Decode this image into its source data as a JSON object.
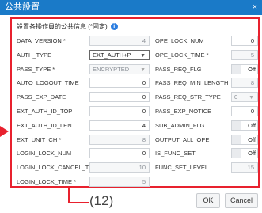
{
  "window": {
    "title": "公共設置",
    "close_label": "×"
  },
  "section": {
    "title": "設置各操作員的公共信息 (*固定)",
    "info_icon": "info-icon"
  },
  "left_fields": [
    {
      "label": "DATA_VERSION *",
      "value": "4",
      "kind": "readonly"
    },
    {
      "label": "AUTH_TYPE",
      "value": "EXT_AUTH+P",
      "kind": "select-active"
    },
    {
      "label": "PASS_TYPE *",
      "value": "ENCRYPTED",
      "kind": "select-disabled"
    },
    {
      "label": "AUTO_LOGOUT_TIME",
      "value": "0",
      "kind": "input"
    },
    {
      "label": "PASS_EXP_DATE",
      "value": "0",
      "kind": "input"
    },
    {
      "label": "EXT_AUTH_ID_TOP",
      "value": "0",
      "kind": "input"
    },
    {
      "label": "EXT_AUTH_ID_LEN",
      "value": "4",
      "kind": "input"
    },
    {
      "label": "EXT_UNIT_CH *",
      "value": "8",
      "kind": "readonly"
    },
    {
      "label": "LOGIN_LOCK_NUM",
      "value": "0",
      "kind": "input"
    },
    {
      "label": "LOGIN_LOCK_CANCEL_TIME",
      "value": "10",
      "kind": "readonly"
    },
    {
      "label": "LOGIN_LOCK_TIME *",
      "value": "5",
      "kind": "readonly"
    }
  ],
  "right_fields": [
    {
      "label": "OPE_LOCK_NUM",
      "value": "0",
      "kind": "input"
    },
    {
      "label": "OPE_LOCK_TIME *",
      "value": "5",
      "kind": "readonly"
    },
    {
      "label": "PASS_REQ_FLG",
      "value": "Off",
      "kind": "toggle"
    },
    {
      "label": "PASS_REQ_MIN_LENGTH",
      "value": "8",
      "kind": "readonly"
    },
    {
      "label": "PASS_REQ_STR_TYPE",
      "value": "0",
      "kind": "select-disabled"
    },
    {
      "label": "PASS_EXP_NOTICE",
      "value": "0",
      "kind": "input"
    },
    {
      "label": "SUB_ADMIN_FLG",
      "value": "Off",
      "kind": "toggle"
    },
    {
      "label": "OUTPUT_ALL_OPE",
      "value": "Off",
      "kind": "toggle"
    },
    {
      "label": "IS_FUNC_SET",
      "value": "Off",
      "kind": "toggle"
    },
    {
      "label": "FUNC_SET_LEVEL",
      "value": "15",
      "kind": "readonly"
    }
  ],
  "buttons": {
    "ok": "OK",
    "cancel": "Cancel"
  },
  "callout": {
    "label": "(12)"
  },
  "colors": {
    "titlebar": "#1a7ac8",
    "highlight": "#e8212e"
  }
}
